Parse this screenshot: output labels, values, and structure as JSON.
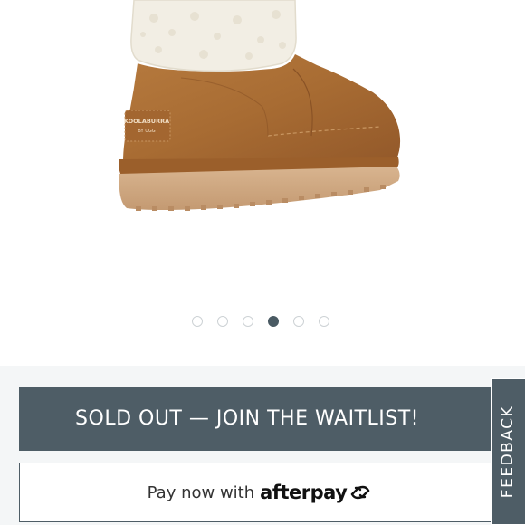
{
  "product_image": {
    "brand_label": "KOOLABURRA",
    "brand_sub_label": "BY UGG"
  },
  "carousel": {
    "total_dots": 6,
    "active_index": 3
  },
  "actions": {
    "waitlist_label": "SOLD OUT — JOIN THE WAITLIST!",
    "pay_now_label": "Pay now with",
    "afterpay_label": "afterpay"
  },
  "feedback": {
    "label": "FEEDBACK"
  },
  "colors": {
    "button_bg": "#4e5d66",
    "panel_bg": "#f4f6f7",
    "active_dot": "#4a5a63",
    "inactive_dot_border": "#cdd2d5"
  }
}
